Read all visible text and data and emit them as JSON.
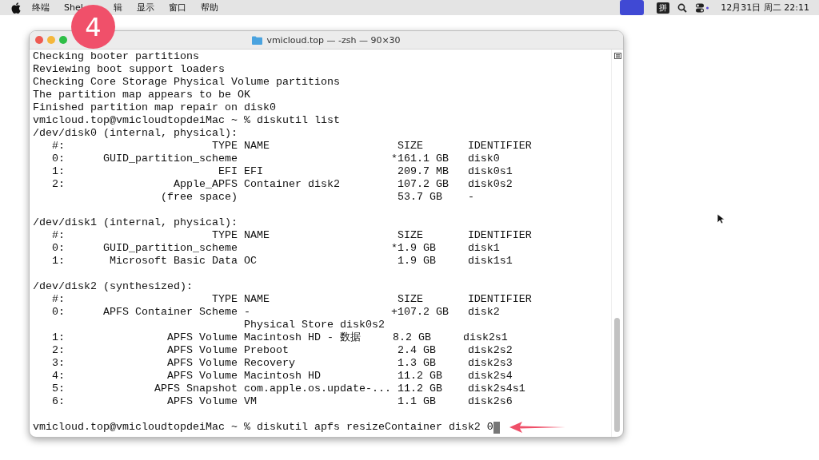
{
  "menubar": {
    "items": [
      "终端",
      "Shel",
      "辑",
      "显示",
      "窗口",
      "帮助"
    ],
    "input_method": "拼",
    "clock": "12月31日 周二 22:11"
  },
  "badge": "4",
  "window": {
    "title": "vmicloud.top — -zsh — 90×30"
  },
  "terminal": {
    "blocks": [
      [
        "Checking booter partitions",
        "Reviewing boot support loaders",
        "Checking Core Storage Physical Volume partitions",
        "The partition map appears to be OK",
        "Finished partition map repair on disk0",
        "vmicloud.top@vmicloudtopdeiMac ~ % diskutil list",
        "/dev/disk0 (internal, physical):",
        "   #:                       TYPE NAME                    SIZE       IDENTIFIER",
        "   0:      GUID_partition_scheme                        *161.1 GB   disk0",
        "   1:                        EFI EFI                     209.7 MB   disk0s1",
        "   2:                 Apple_APFS Container disk2         107.2 GB   disk0s2",
        "                    (free space)                         53.7 GB    -"
      ],
      [
        "/dev/disk1 (internal, physical):",
        "   #:                       TYPE NAME                    SIZE       IDENTIFIER",
        "   0:      GUID_partition_scheme                        *1.9 GB     disk1",
        "   1:       Microsoft Basic Data OC                      1.9 GB     disk1s1"
      ],
      [
        "/dev/disk2 (synthesized):",
        "   #:                       TYPE NAME                    SIZE       IDENTIFIER",
        "   0:      APFS Container Scheme -                      +107.2 GB   disk2",
        "                                 Physical Store disk0s2",
        "   1:                APFS Volume Macintosh HD - 数据     8.2 GB     disk2s1",
        "   2:                APFS Volume Preboot                 2.4 GB     disk2s2",
        "   3:                APFS Volume Recovery                1.3 GB     disk2s3",
        "   4:                APFS Volume Macintosh HD            11.2 GB    disk2s4",
        "   5:              APFS Snapshot com.apple.os.update-... 11.2 GB    disk2s4s1",
        "   6:                APFS Volume VM                      1.1 GB     disk2s6"
      ]
    ],
    "prompt": "vmicloud.top@vmicloudtopdeiMac ~ % diskutil apfs resizeContainer disk2 0"
  }
}
